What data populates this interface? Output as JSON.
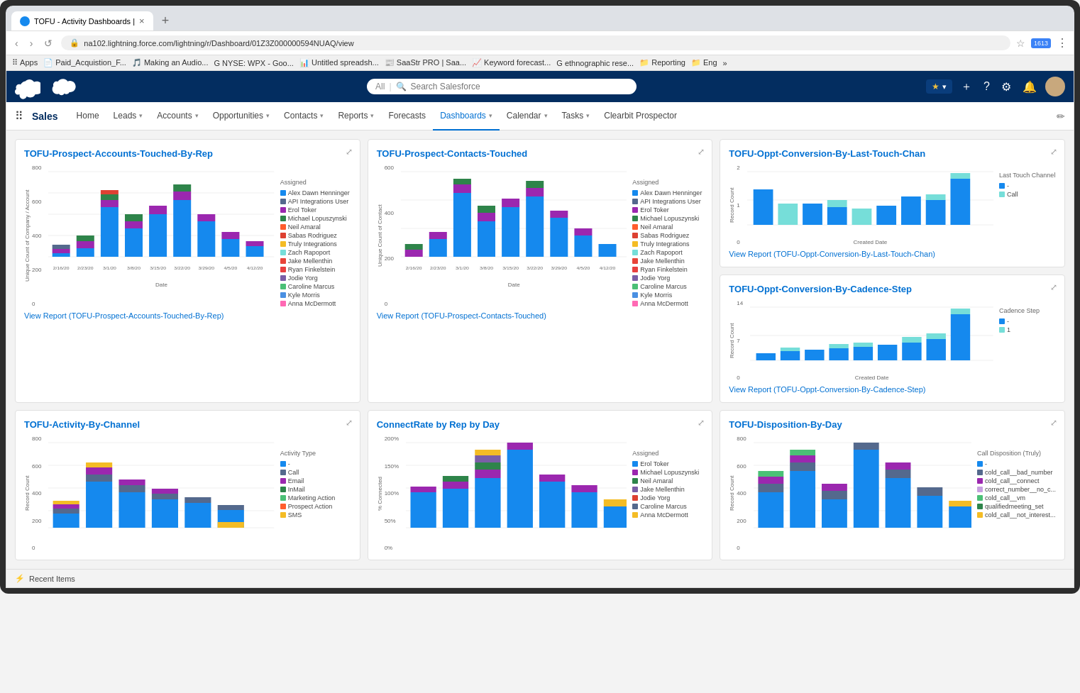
{
  "browser": {
    "tab_title": "TOFU - Activity Dashboards |",
    "tab_close": "×",
    "new_tab": "+",
    "address": "na102.lightning.force.com/lightning/r/Dashboard/01Z3Z000000594NUAQ/view",
    "nav_back": "‹",
    "nav_forward": "›",
    "nav_refresh": "↺",
    "bookmarks": [
      {
        "label": "Apps"
      },
      {
        "label": "Paid_Acquistion_F..."
      },
      {
        "label": "Making an Audio..."
      },
      {
        "label": "NYSE: WPX - Goo..."
      },
      {
        "label": "Untitled spreadsh..."
      },
      {
        "label": "SaaStr PRO | Saa..."
      },
      {
        "label": "Keyword forecast..."
      },
      {
        "label": "ethnographic rese..."
      },
      {
        "label": "Reporting"
      },
      {
        "label": "Eng"
      },
      {
        "label": "»"
      }
    ]
  },
  "header": {
    "search_placeholder": "Search Salesforce",
    "search_all_label": "All"
  },
  "nav": {
    "app_name": "Sales",
    "items": [
      {
        "label": "Home",
        "has_chevron": false
      },
      {
        "label": "Leads",
        "has_chevron": true
      },
      {
        "label": "Accounts",
        "has_chevron": true
      },
      {
        "label": "Opportunities",
        "has_chevron": true
      },
      {
        "label": "Contacts",
        "has_chevron": true
      },
      {
        "label": "Reports",
        "has_chevron": true
      },
      {
        "label": "Forecasts",
        "has_chevron": false
      },
      {
        "label": "Dashboards",
        "has_chevron": true,
        "active": true
      },
      {
        "label": "Calendar",
        "has_chevron": true
      },
      {
        "label": "Tasks",
        "has_chevron": true
      },
      {
        "label": "Clearbit Prospector",
        "has_chevron": false
      }
    ]
  },
  "charts": {
    "top_row": [
      {
        "id": "prospect-accounts",
        "title": "TOFU-Prospect-Accounts-Touched-By-Rep",
        "view_report": "View Report (TOFU-Prospect-Accounts-Touched-By-Rep)",
        "legend_label": "Assigned",
        "y_axis": "Unique Count of Company / Account",
        "x_axis": "Date",
        "legend": [
          {
            "label": "Alex Dawn Henninger",
            "color": "#1589ee"
          },
          {
            "label": "API Integrations User",
            "color": "#54698d"
          },
          {
            "label": "Erol Toker",
            "color": "#9b27af"
          },
          {
            "label": "Michael Lopuszynski",
            "color": "#2e844a"
          },
          {
            "label": "Neil Amaral",
            "color": "#ff5d2d"
          },
          {
            "label": "Sabas Rodriguez",
            "color": "#dd4132"
          },
          {
            "label": "Truly Integrations",
            "color": "#f4bc25"
          },
          {
            "label": "Zach Rapoport",
            "color": "#76ded9"
          },
          {
            "label": "Jake Mellenthin",
            "color": "#e84439"
          },
          {
            "label": "Ryan Finkelstein",
            "color": "#e94040"
          },
          {
            "label": "Jodie Yorg",
            "color": "#7b5ea7"
          },
          {
            "label": "Caroline Marcus",
            "color": "#4bc076"
          },
          {
            "label": "Kyle Morris",
            "color": "#4a90e2"
          },
          {
            "label": "Anna McDermott",
            "color": "#ff69b4"
          }
        ],
        "y_ticks": [
          "800",
          "600",
          "400",
          "200",
          "0"
        ],
        "x_labels": [
          "2/16/2020 - 2/...",
          "2/23/2020 - 2/...",
          "3/1/2020 - 3/...",
          "3/8/2020 - 3/...",
          "3/15/2020 - 3/...",
          "3/22/2020 - 3/...",
          "3/29/2020 - 4/...",
          "4/5/2020 - 4/1...",
          "4/12/2020 - 4/..."
        ]
      },
      {
        "id": "prospect-contacts",
        "title": "TOFU-Prospect-Contacts-Touched",
        "view_report": "View Report (TOFU-Prospect-Contacts-Touched)",
        "legend_label": "Assigned",
        "y_axis": "Unique Count of Contact",
        "x_axis": "Date",
        "legend": [
          {
            "label": "Alex Dawn Henninger",
            "color": "#1589ee"
          },
          {
            "label": "API Integrations User",
            "color": "#54698d"
          },
          {
            "label": "Erol Toker",
            "color": "#9b27af"
          },
          {
            "label": "Michael Lopuszynski",
            "color": "#2e844a"
          },
          {
            "label": "Neil Amaral",
            "color": "#ff5d2d"
          },
          {
            "label": "Sabas Rodriguez",
            "color": "#dd4132"
          },
          {
            "label": "Truly Integrations",
            "color": "#f4bc25"
          },
          {
            "label": "Zach Rapoport",
            "color": "#76ded9"
          },
          {
            "label": "Jake Mellenthin",
            "color": "#e84439"
          },
          {
            "label": "Ryan Finkelstein",
            "color": "#e94040"
          },
          {
            "label": "Jodie Yorg",
            "color": "#7b5ea7"
          },
          {
            "label": "Caroline Marcus",
            "color": "#4bc076"
          },
          {
            "label": "Kyle Morris",
            "color": "#4a90e2"
          },
          {
            "label": "Anna McDermott",
            "color": "#ff69b4"
          }
        ],
        "y_ticks": [
          "600",
          "400",
          "200",
          "0"
        ],
        "x_labels": [
          "2/16/2020 - 2/...",
          "2/23/2020 - 2/...",
          "3/1/2020 - 3/...",
          "3/8/2020 - 3/...",
          "3/15/2020 - 3/...",
          "3/22/2020 - 3/...",
          "3/29/2020 - 4/...",
          "4/5/2020 - 4/1...",
          "4/12/2020 - 4/..."
        ]
      },
      {
        "id": "oppt-conversion-last-touch",
        "title": "TOFU-Oppt-Conversion-By-Last-Touch-Chan",
        "view_report": "View Report (TOFU-Oppt-Conversion-By-Last-Touch-Chan)",
        "legend_label": "Last Touch Channel",
        "y_axis": "Record Count",
        "x_axis": "Created Date",
        "legend": [
          {
            "label": "-",
            "color": "#1589ee"
          },
          {
            "label": "Call",
            "color": "#76ded9"
          }
        ],
        "y_ticks": [
          "2",
          "1",
          "0"
        ]
      }
    ],
    "middle_right": {
      "id": "oppt-conversion-cadence",
      "title": "TOFU-Oppt-Conversion-By-Cadence-Step",
      "view_report": "View Report (TOFU-Oppt-Conversion-By-Cadence-Step)",
      "legend_label": "Cadence Step",
      "y_axis": "Record Count",
      "x_axis": "Created Date",
      "legend": [
        {
          "label": "-",
          "color": "#1589ee"
        },
        {
          "label": "1",
          "color": "#76ded9"
        }
      ],
      "y_ticks": [
        "14",
        "7",
        "0"
      ]
    },
    "bottom_row": [
      {
        "id": "activity-by-channel",
        "title": "TOFU-Activity-By-Channel",
        "legend_label": "Activity Type",
        "y_axis": "Record Count",
        "x_axis": "",
        "legend": [
          {
            "label": "-",
            "color": "#1589ee"
          },
          {
            "label": "Call",
            "color": "#54698d"
          },
          {
            "label": "Email",
            "color": "#9b27af"
          },
          {
            "label": "InMail",
            "color": "#2e844a"
          },
          {
            "label": "Marketing Action",
            "color": "#4bc076"
          },
          {
            "label": "Prospect Action",
            "color": "#ff5d2d"
          },
          {
            "label": "SMS",
            "color": "#f4bc25"
          }
        ],
        "y_ticks": [
          "800",
          "600",
          "400",
          "200",
          "0"
        ]
      },
      {
        "id": "connect-rate",
        "title": "ConnectRate by Rep by Day",
        "legend_label": "Assigned",
        "y_axis": "% Connected",
        "x_axis": "",
        "legend": [
          {
            "label": "Erol Toker",
            "color": "#1589ee"
          },
          {
            "label": "Michael Lopuszynski",
            "color": "#9b27af"
          },
          {
            "label": "Neil Amaral",
            "color": "#2e844a"
          },
          {
            "label": "Jake Mellenthin",
            "color": "#7b5ea7"
          },
          {
            "label": "Jodie Yorg",
            "color": "#dd4132"
          },
          {
            "label": "Caroline Marcus",
            "color": "#54698d"
          },
          {
            "label": "Anna McDermott",
            "color": "#f4bc25"
          }
        ],
        "y_ticks": [
          "200%",
          "150%",
          "100%",
          "50%",
          "0%"
        ]
      },
      {
        "id": "disposition-by-day",
        "title": "TOFU-Disposition-By-Day",
        "legend_label": "Call Disposition (Truly)",
        "y_axis": "Record Count",
        "x_axis": "",
        "legend": [
          {
            "label": "-",
            "color": "#1589ee"
          },
          {
            "label": "cold_call__bad_number",
            "color": "#54698d"
          },
          {
            "label": "cold_call__connect",
            "color": "#9b27af"
          },
          {
            "label": "correct_number__no_c...",
            "color": "#c8a0e0"
          },
          {
            "label": "cold_call__vm",
            "color": "#4bc076"
          },
          {
            "label": "qualifiedmeeting_set",
            "color": "#2e844a"
          },
          {
            "label": "cold_call__not_interest...",
            "color": "#f4bc25"
          }
        ],
        "y_ticks": [
          "800",
          "600",
          "400",
          "200",
          "0"
        ]
      }
    ]
  },
  "footer": {
    "icon": "⚡",
    "label": "Recent Items"
  }
}
